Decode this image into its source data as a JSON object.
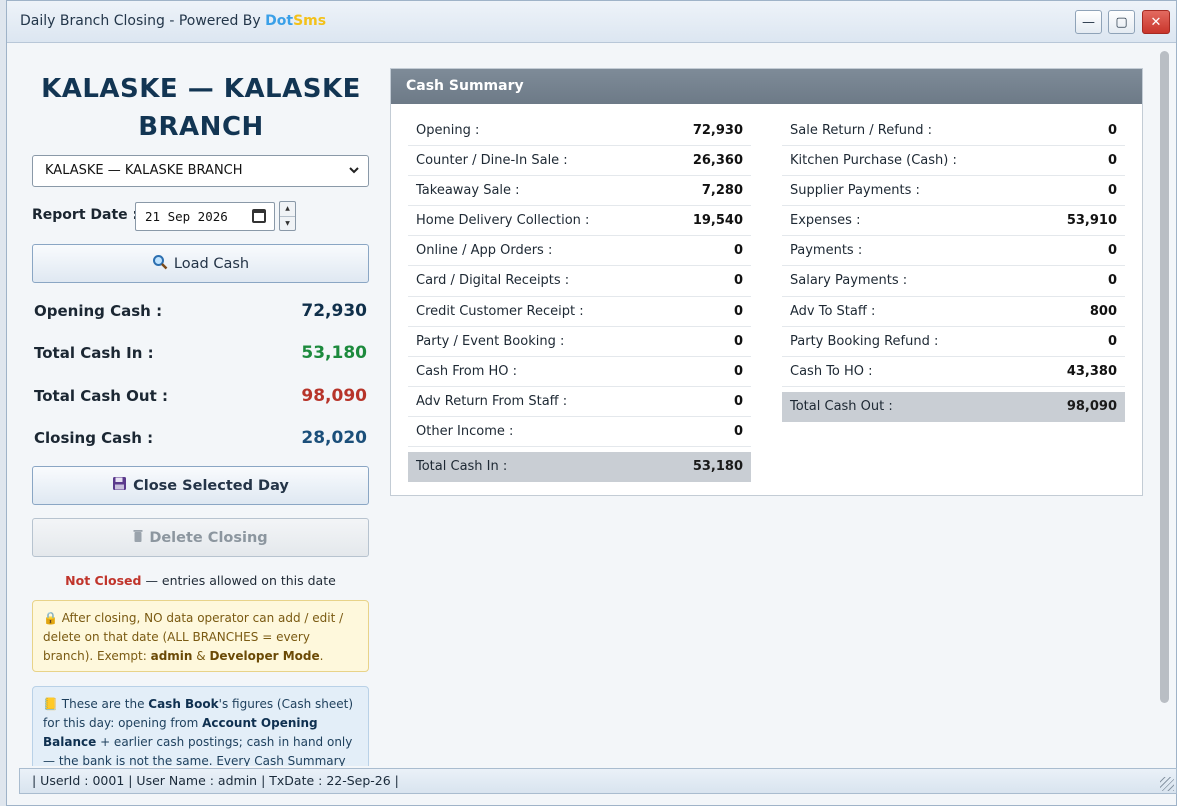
{
  "window": {
    "title_prefix": "Daily Branch Closing - Powered By ",
    "brand_part1": "Dot",
    "brand_part2": "Sms",
    "btn_min": "—",
    "btn_max": "▢",
    "btn_close": "✕"
  },
  "left": {
    "branch_title": "KALASKE — KALASKE BRANCH",
    "branch_select": "KALASKE — KALASKE BRANCH",
    "report_date_label": "Report Date :",
    "report_date_value": "21 Sep 2026",
    "load_button": "Load Cash",
    "opening_label": "Opening Cash :",
    "opening_value": "72,930",
    "cash_in_label": "Total Cash In :",
    "cash_in_value": "53,180",
    "cash_out_label": "Total Cash Out :",
    "cash_out_value": "98,090",
    "closing_label": "Closing Cash :",
    "closing_value": "28,020",
    "close_day_button": "Close Selected Day",
    "delete_button": "Delete Closing",
    "status_word": "Not Closed",
    "status_rest": " — entries allowed on this date",
    "warn": {
      "t1": " After closing, NO data operator can add / edit / delete on that date (ALL BRANCHES = every branch). Exempt: ",
      "b1": "admin",
      "t2": " & ",
      "b2": "Developer Mode",
      "t3": "."
    },
    "info": {
      "t1": " These are the ",
      "b1": "Cash Book",
      "t2": "'s figures (Cash sheet) for this day: opening from ",
      "b2": "Account Opening Balance",
      "t3": " + earlier cash postings; cash in hand only — the bank is not the same. Every Cash Summary row is one of the"
    }
  },
  "summary": {
    "title": "Cash Summary",
    "cash_in": [
      {
        "label": "Opening :",
        "value": "72,930"
      },
      {
        "label": "Counter / Dine-In Sale :",
        "value": "26,360"
      },
      {
        "label": "Takeaway Sale :",
        "value": "7,280"
      },
      {
        "label": "Home Delivery Collection :",
        "value": "19,540"
      },
      {
        "label": "Online / App Orders :",
        "value": "0"
      },
      {
        "label": "Card / Digital Receipts :",
        "value": "0"
      },
      {
        "label": "Credit Customer Receipt :",
        "value": "0"
      },
      {
        "label": "Party / Event Booking :",
        "value": "0"
      },
      {
        "label": "Cash From HO :",
        "value": "0"
      },
      {
        "label": "Adv Return From Staff :",
        "value": "0"
      },
      {
        "label": "Other Income :",
        "value": "0"
      }
    ],
    "total_in": {
      "label": "Total Cash In :",
      "value": "53,180"
    },
    "cash_out": [
      {
        "label": "Sale Return / Refund :",
        "value": "0"
      },
      {
        "label": "Kitchen Purchase (Cash) :",
        "value": "0"
      },
      {
        "label": "Supplier Payments :",
        "value": "0"
      },
      {
        "label": "Expenses :",
        "value": "53,910"
      },
      {
        "label": "Payments :",
        "value": "0"
      },
      {
        "label": "Salary Payments :",
        "value": "0"
      },
      {
        "label": "Adv To Staff :",
        "value": "800"
      },
      {
        "label": "Party Booking Refund :",
        "value": "0"
      },
      {
        "label": "Cash To HO :",
        "value": "43,380"
      }
    ],
    "total_out": {
      "label": "Total Cash Out :",
      "value": "98,090"
    }
  },
  "statusbar": {
    "text": "| UserId : 0001  |  User Name : admin  |  TxDate : 22-Sep-26 |"
  }
}
